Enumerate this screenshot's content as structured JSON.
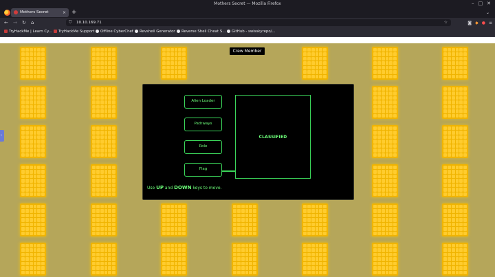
{
  "window": {
    "title": "Mothers Secret — Mozilla Firefox"
  },
  "tabs": [
    {
      "title": "Mothers Secret",
      "close": "×"
    }
  ],
  "new_tab": "+",
  "nav": {
    "url": "10.10.169.71"
  },
  "bookmarks": [
    "TryHackMe | Learn Cy...",
    "TryHackMe Support",
    "Offline CyberChef",
    "Revshell Generator",
    "Reverse Shell Cheat S...",
    "GitHub - swisskyrepo/..."
  ],
  "game": {
    "crew_label": "Crew Member",
    "menu": [
      "Alien Loader",
      "Pathways",
      "Role",
      "Flag"
    ],
    "display_text": "CLASSIFIED",
    "hint": {
      "pre": "Use",
      "up": "UP",
      "and": "and",
      "down": "DOWN",
      "post": "keys to move."
    },
    "colors": {
      "background": "#b5a65a",
      "panel": "#f0b400",
      "terminal": "#000000",
      "accent": "#6dff7a"
    }
  }
}
